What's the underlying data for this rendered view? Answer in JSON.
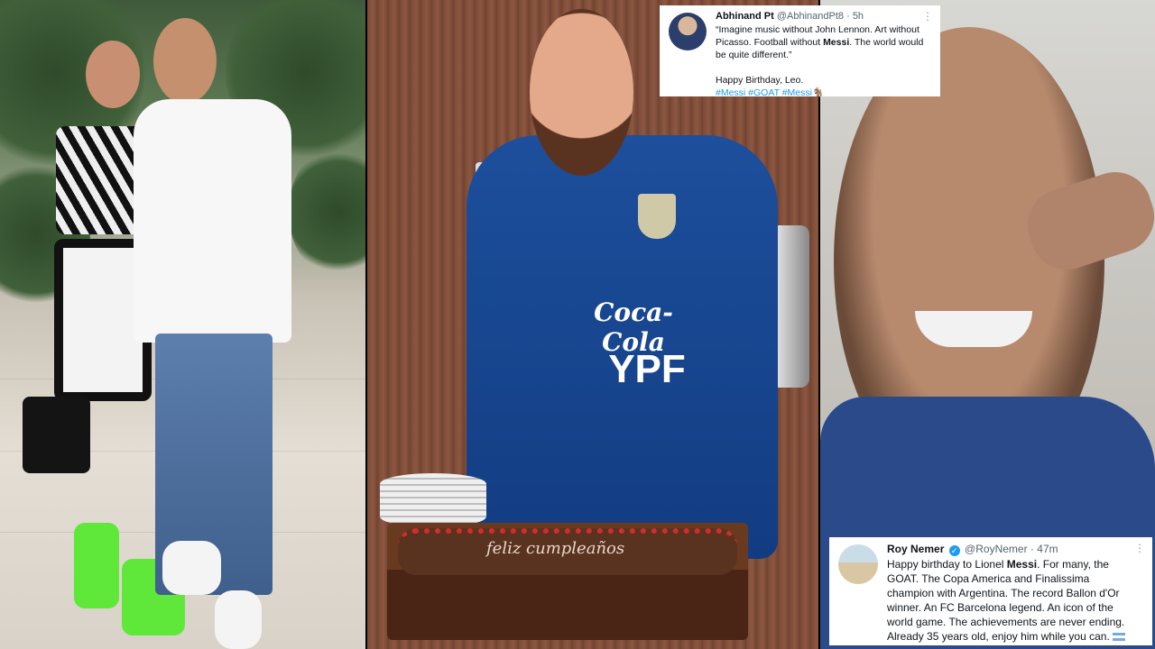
{
  "panels": {
    "left": {
      "description_name": "couple-photo"
    },
    "center": {
      "jersey_brand_1": "Coca-Cola",
      "jersey_brand_2": "YPF",
      "cake_text": "feliz cumpleaños"
    },
    "right": {
      "description_name": "video-selfie"
    }
  },
  "tweet_top": {
    "name": "Abhinand Pt",
    "handle": "@AbhinandPt8",
    "time": "5h",
    "line1": "“Imagine music without John Lennon. Art without",
    "line2": "Picasso. Football without ",
    "line2_bold": "Messi",
    "line2_end": ". The world would",
    "line3": "be quite different.”",
    "line4": "Happy Birthday, Leo.",
    "tags": "#Messi #GOAT #Messi🐐"
  },
  "tweet_bottom": {
    "name": "Roy Nemer",
    "handle": "@RoyNemer",
    "time": "47m",
    "line1_start": "Happy birthday to Lionel ",
    "line1_bold": "Messi",
    "line1_end": ". For many, the",
    "line2": "GOAT. The Copa America and Finalissima",
    "line3": "champion with Argentina. The record Ballon d'Or",
    "line4": "winner. An FC Barcelona legend. An icon of the",
    "line5": "world game. The achievements are never ending.",
    "line6": "Already 35 years old, enjoy him while you can."
  },
  "colors": {
    "link": "#1d9bf0",
    "jersey": "#1d4f9c",
    "verified": "#1d9bf0"
  },
  "icons": {
    "more": "more-dots-icon",
    "verified": "verified-badge-icon",
    "flag": "argentina-flag-icon"
  }
}
